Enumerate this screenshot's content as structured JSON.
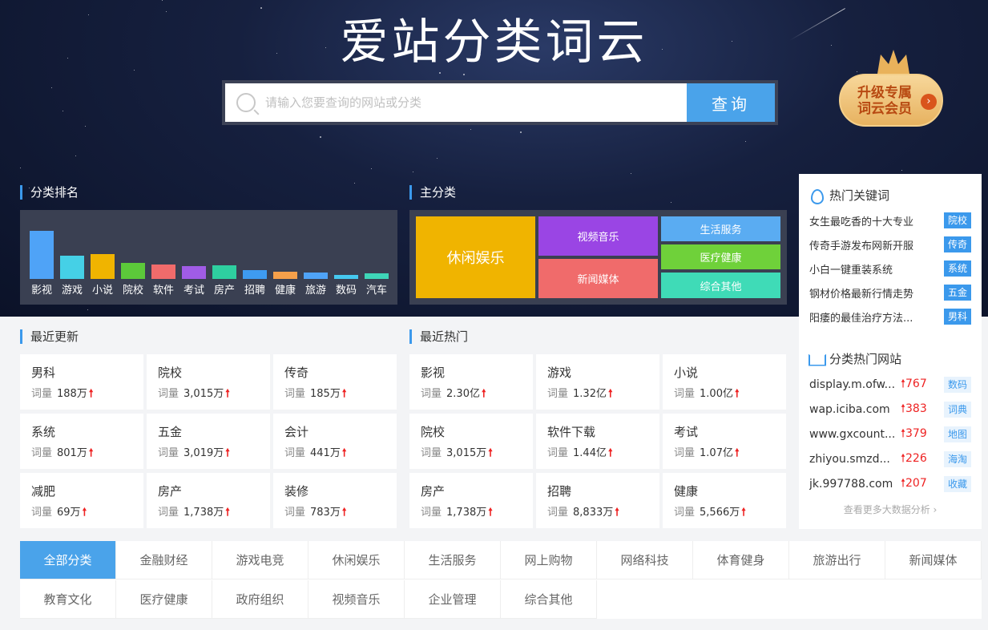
{
  "header": {
    "title": "爱站分类词云",
    "search_placeholder": "请输入您要查询的网站或分类",
    "search_button": "查询",
    "vip_line1": "升级专属",
    "vip_line2": "词云会员"
  },
  "ranking": {
    "title": "分类排名",
    "items": [
      {
        "label": "影视",
        "value": 100,
        "color": "#4fa3f7"
      },
      {
        "label": "游戏",
        "value": 48,
        "color": "#45d0e6"
      },
      {
        "label": "小说",
        "value": 52,
        "color": "#f0b400"
      },
      {
        "label": "院校",
        "value": 33,
        "color": "#5cc93a"
      },
      {
        "label": "软件",
        "value": 30,
        "color": "#f06b6b"
      },
      {
        "label": "考试",
        "value": 26,
        "color": "#a05ce6"
      },
      {
        "label": "房产",
        "value": 28,
        "color": "#2ecfa0"
      },
      {
        "label": "招聘",
        "value": 18,
        "color": "#3e9bf0"
      },
      {
        "label": "健康",
        "value": 15,
        "color": "#f5a04a"
      },
      {
        "label": "旅游",
        "value": 13,
        "color": "#4fa3f7"
      },
      {
        "label": "数码",
        "value": 9,
        "color": "#45c8ef"
      },
      {
        "label": "汽车",
        "value": 12,
        "color": "#3ed6b8"
      }
    ]
  },
  "main_category": {
    "title": "主分类",
    "tiles": [
      {
        "label": "休闲娱乐",
        "color": "#f0b400"
      },
      {
        "label": "视频音乐",
        "color": "#9a45e4"
      },
      {
        "label": "新闻媒体",
        "color": "#f06b6b"
      },
      {
        "label": "生活服务",
        "color": "#5aacf2"
      },
      {
        "label": "医疗健康",
        "color": "#6fd13a"
      },
      {
        "label": "综合其他",
        "color": "#3fdbb7"
      }
    ]
  },
  "recent_updates": {
    "title": "最近更新",
    "stat_label": "词量",
    "up_arrow": "🠕",
    "cards": [
      {
        "name": "男科",
        "count": "188万"
      },
      {
        "name": "院校",
        "count": "3,015万"
      },
      {
        "name": "传奇",
        "count": "185万"
      },
      {
        "name": "系统",
        "count": "801万"
      },
      {
        "name": "五金",
        "count": "3,019万"
      },
      {
        "name": "会计",
        "count": "441万"
      },
      {
        "name": "减肥",
        "count": "69万"
      },
      {
        "name": "房产",
        "count": "1,738万"
      },
      {
        "name": "装修",
        "count": "783万"
      }
    ]
  },
  "recent_hot": {
    "title": "最近热门",
    "cards": [
      {
        "name": "影视",
        "count": "2.30亿"
      },
      {
        "name": "游戏",
        "count": "1.32亿"
      },
      {
        "name": "小说",
        "count": "1.00亿"
      },
      {
        "name": "院校",
        "count": "3,015万"
      },
      {
        "name": "软件下载",
        "count": "1.44亿"
      },
      {
        "name": "考试",
        "count": "1.07亿"
      },
      {
        "name": "房产",
        "count": "1,738万"
      },
      {
        "name": "招聘",
        "count": "8,833万"
      },
      {
        "name": "健康",
        "count": "5,566万"
      }
    ]
  },
  "hot_keywords": {
    "title": "热门关键词",
    "items": [
      {
        "text": "女生最吃香的十大专业",
        "tag": "院校"
      },
      {
        "text": "传奇手游发布网新开服",
        "tag": "传奇"
      },
      {
        "text": "小白一键重装系统",
        "tag": "系统"
      },
      {
        "text": "钢材价格最新行情走势",
        "tag": "五金"
      },
      {
        "text": "阳痿的最佳治疗方法...",
        "tag": "男科"
      }
    ]
  },
  "hot_sites": {
    "title": "分类热门网站",
    "items": [
      {
        "domain": "display.m.ofw...",
        "count": "767",
        "tag": "数码"
      },
      {
        "domain": "wap.iciba.com",
        "count": "383",
        "tag": "词典"
      },
      {
        "domain": "www.gxcount...",
        "count": "379",
        "tag": "地图"
      },
      {
        "domain": "zhiyou.smzd...",
        "count": "226",
        "tag": "海淘"
      },
      {
        "domain": "jk.997788.com",
        "count": "207",
        "tag": "收藏"
      }
    ],
    "more": "查看更多大数据分析 ›"
  },
  "tabs": [
    "全部分类",
    "金融财经",
    "游戏电竞",
    "休闲娱乐",
    "生活服务",
    "网上购物",
    "网络科技",
    "体育健身",
    "旅游出行",
    "新闻媒体",
    "教育文化",
    "医疗健康",
    "政府组织",
    "视频音乐",
    "企业管理",
    "综合其他"
  ]
}
